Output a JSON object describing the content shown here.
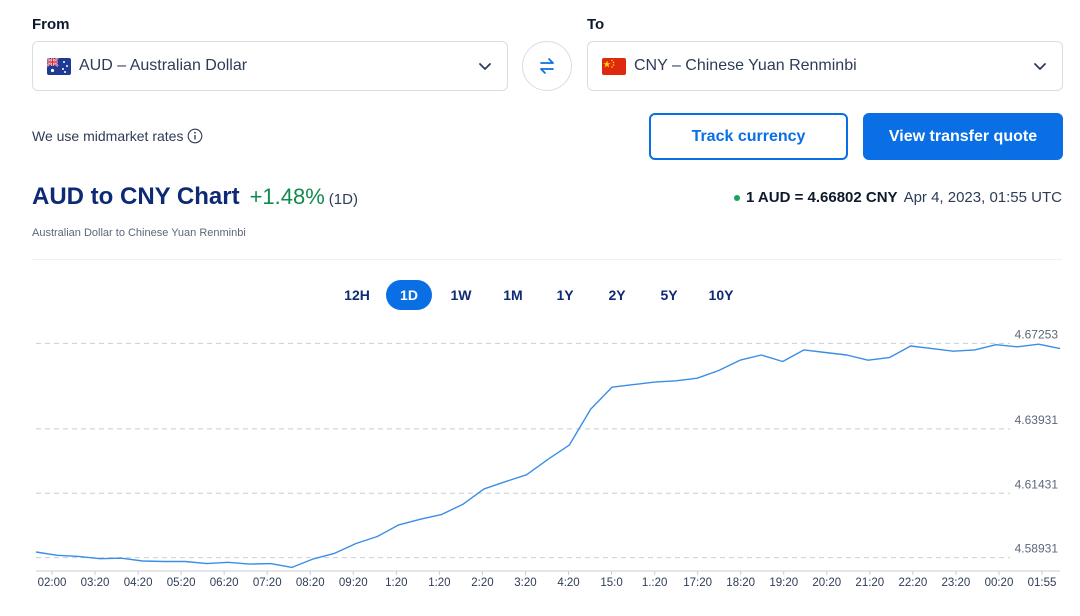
{
  "from": {
    "label": "From",
    "currency": "AUD – Australian Dollar",
    "flag_icon": "australia-flag-icon"
  },
  "to": {
    "label": "To",
    "currency": "CNY – Chinese Yuan Renminbi",
    "flag_icon": "china-flag-icon"
  },
  "swap_icon": "swap-arrows-icon",
  "midmarket_text": "We use midmarket rates",
  "buttons": {
    "track": "Track currency",
    "quote": "View transfer quote"
  },
  "header": {
    "title": "AUD to CNY Chart",
    "change": "+1.48%",
    "period": "(1D)",
    "subtitle": "Australian Dollar to Chinese Yuan Renminbi",
    "rate": "1 AUD = 4.66802 CNY",
    "timestamp": "Apr 4, 2023, 01:55 UTC"
  },
  "ranges": [
    "12H",
    "1D",
    "1W",
    "1M",
    "1Y",
    "2Y",
    "5Y",
    "10Y"
  ],
  "active_range": "1D",
  "colors": {
    "accent": "#0a6fe5",
    "positive": "#118b4f",
    "line": "#3a8ee6",
    "title": "#0e2a74"
  },
  "chart_data": {
    "type": "line",
    "title": "",
    "xlabel": "",
    "ylabel": "",
    "ylim": [
      4.5845,
      4.6785
    ],
    "yticks": [
      4.58931,
      4.61431,
      4.63931,
      4.67253
    ],
    "grid": true,
    "xticks": [
      "02:00",
      "03:20",
      "04:20",
      "05:20",
      "06:20",
      "07:20",
      "08:20",
      "09:20",
      "1:20",
      "1:20",
      "2:20",
      "3:20",
      "4:20",
      "15:0",
      "1.:20",
      "17:20",
      "18:20",
      "19:20",
      "20:20",
      "21:20",
      "22:20",
      "23:20",
      "00:20",
      "01:55"
    ],
    "series": [
      {
        "name": "",
        "x": [
          0,
          0.5,
          1,
          1.5,
          2,
          2.5,
          3,
          3.5,
          4,
          4.5,
          5,
          5.5,
          6,
          6.5,
          7,
          7.5,
          8,
          8.5,
          9,
          9.5,
          10,
          10.5,
          11,
          11.5,
          12,
          12.5,
          13,
          13.5,
          14,
          14.5,
          15,
          15.5,
          16,
          16.5,
          17,
          17.5,
          18,
          18.5,
          19,
          19.5,
          20,
          20.5,
          21,
          21.5,
          22,
          22.5,
          23,
          23.5,
          24
        ],
        "y": [
          4.5915,
          4.5902,
          4.5898,
          4.5889,
          4.5891,
          4.588,
          4.5878,
          4.5878,
          4.587,
          4.5875,
          4.5868,
          4.587,
          4.5855,
          4.5888,
          4.591,
          4.5948,
          4.5975,
          4.602,
          4.6042,
          4.606,
          4.61,
          4.616,
          4.6188,
          4.6215,
          4.6275,
          4.633,
          4.647,
          4.6555,
          4.6565,
          4.6575,
          4.658,
          4.659,
          4.662,
          4.666,
          4.668,
          4.6655,
          4.67,
          4.669,
          4.668,
          4.666,
          4.667,
          4.6715,
          4.6705,
          4.6695,
          4.67,
          4.672,
          4.6712,
          4.6722,
          4.6705
        ]
      }
    ]
  }
}
